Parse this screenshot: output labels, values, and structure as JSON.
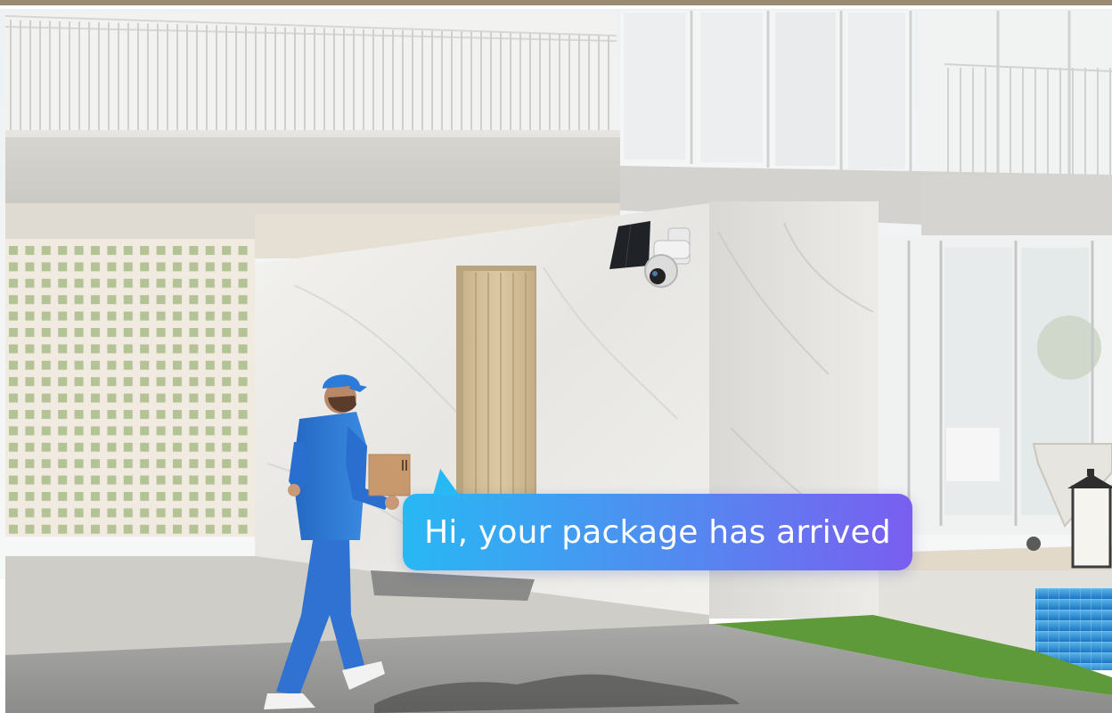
{
  "speech_bubble": {
    "text": "Hi, your package has arrived"
  },
  "colors": {
    "uniform_blue": "#2c7ad6",
    "bubble_gradient_start": "#28b8f4",
    "bubble_gradient_end": "#7a5ef0",
    "marble": "#ecebe8",
    "pool": "#2f8fd8",
    "lawn": "#5f9a3a"
  },
  "icons": [
    "solar-panel-icon",
    "security-camera-icon",
    "lantern-icon"
  ]
}
